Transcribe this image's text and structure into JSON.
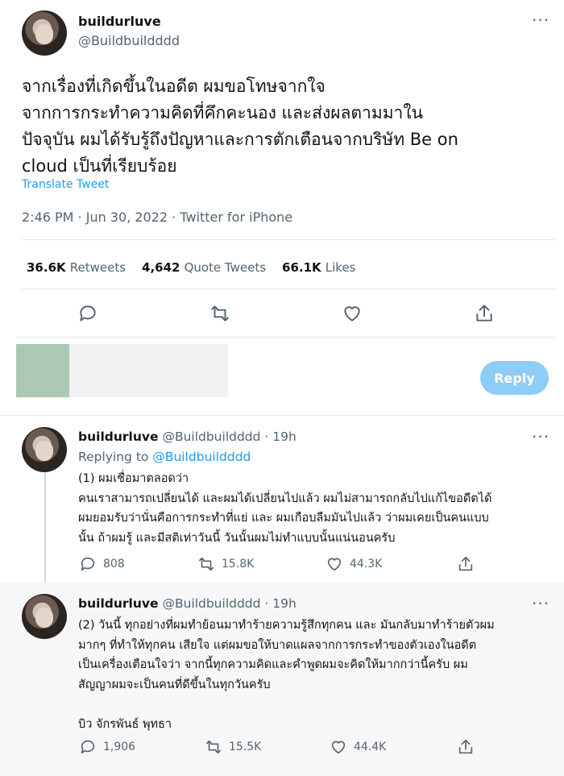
{
  "main_tweet": {
    "display_name": "buildurluve",
    "handle": "@Buildbuildddd",
    "lines": [
      "จากเรื่องที่เกิดขึ้นในอดีต ผมขอโทษจากใจ",
      "จากการกระทำความคิดที่คึกคะนอง และส่งผลตามมาใน",
      "ปัจจุบัน ผมได้รับรู้ถึงปัญหาและการตักเตือนจากบริษัท Be on",
      "cloud เป็นที่เรียบร้อย"
    ],
    "translate_label": "Translate Tweet",
    "timestamp": "2:46 PM · Jun 30, 2022 · Twitter for iPhone",
    "stats": {
      "retweets_count": "36.6K",
      "retweets_label": "Retweets",
      "quotes_count": "4,642",
      "quotes_label": "Quote Tweets",
      "likes_count": "66.1K",
      "likes_label": "Likes"
    }
  },
  "composer": {
    "reply_button_label": "Reply"
  },
  "replies": [
    {
      "display_name": "buildurluve",
      "handle_time": "@Buildbuildddd · 19h",
      "replying_prefix": "Replying to",
      "replying_handle": "@Buildbuildddd",
      "text": "(1) ผมเชื่อมาตลอดว่า\nคนเราสามารถเปลี่ยนได้ และผมได้เปลี่ยนไปแล้ว ผมไม่สามารถกลับไปแก้ไขอดีตได้\nผมยอมรับว่านั่นคือการกระทำที่แย่ และ ผมเกือบลืมมันไปแล้ว ว่าผมเคยเป็นคนแบบ\nนั้น ถ้าผมรู้ และมีสติเท่าวันนี้ วันนั้นผมไม่ทำแบบนั้นแน่นอนครับ",
      "reply_count": "808",
      "retweet_count": "15.8K",
      "like_count": "44.3K"
    },
    {
      "display_name": "buildurluve",
      "handle_time": "@Buildbuildddd · 19h",
      "text": "(2) วันนี้ ทุกอย่างที่ผมทำย้อนมาทำร้ายความรู้สึกทุกคน และ มันกลับมาทำร้ายตัวผม\nมากๆ ที่ทำให้ทุกคน เสียใจ แต่ผมขอให้บาดแผลจากการกระทำของตัวเองในอดีต\nเป็นเครื่องเตือนใจว่า จากนี้ทุกความคิดและคำพูดผมจะคิดให้มากกว่านี้ครับ ผม\nสัญญาผมจะเป็นคนที่ดีขึ้นในทุกวันครับ\n\nบิว จักรพันธ์ พุทธา",
      "reply_count": "1,906",
      "retweet_count": "15.5K",
      "like_count": "44.4K"
    }
  ],
  "icons": [
    "reply-icon",
    "retweet-icon",
    "like-icon",
    "share-icon",
    "more-icon"
  ],
  "colors": {
    "accent": "#1d9bf0",
    "reply_button": "#8ecdf8",
    "muted": "#536471"
  }
}
